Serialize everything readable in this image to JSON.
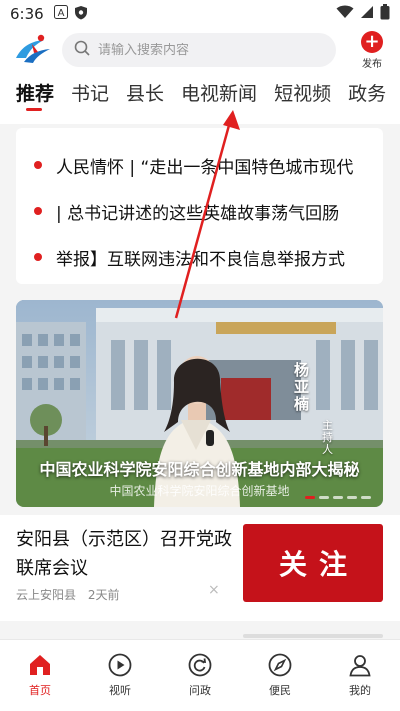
{
  "status_bar": {
    "time": "6:36"
  },
  "search": {
    "placeholder": "请输入搜索内容"
  },
  "publish": {
    "label": "发布"
  },
  "tabs": [
    {
      "label": "推荐",
      "active": true
    },
    {
      "label": "书记"
    },
    {
      "label": "县长"
    },
    {
      "label": "电视新闻"
    },
    {
      "label": "短视频"
    },
    {
      "label": "政务"
    }
  ],
  "headlines": [
    {
      "text": "人民情怀 | “走出一条中国特色城市现代"
    },
    {
      "text": "| 总书记讲述的这些英雄故事荡气回肠"
    },
    {
      "text": "举报】互联网违法和不良信息举报方式"
    }
  ],
  "banner": {
    "caption": "中国农业科学院安阳综合创新基地内部大揭秘",
    "subtitle": "中国农业科学院安阳综合创新基地",
    "anchor_name": "杨亚楠",
    "anchor_role": "主持人"
  },
  "news_item": {
    "title": "安阳县（示范区）召开党政联席会议",
    "source": "云上安阳县",
    "time": "2天前",
    "close": "×",
    "thumb_text": "关注"
  },
  "bottom_nav": [
    {
      "label": "首页",
      "icon": "home-icon",
      "active": true
    },
    {
      "label": "视听",
      "icon": "play-icon"
    },
    {
      "label": "问政",
      "icon": "refresh-icon"
    },
    {
      "label": "便民",
      "icon": "compass-icon"
    },
    {
      "label": "我的",
      "icon": "user-icon"
    }
  ],
  "colors": {
    "accent": "#e02020",
    "thumb_red": "#c5121a"
  }
}
